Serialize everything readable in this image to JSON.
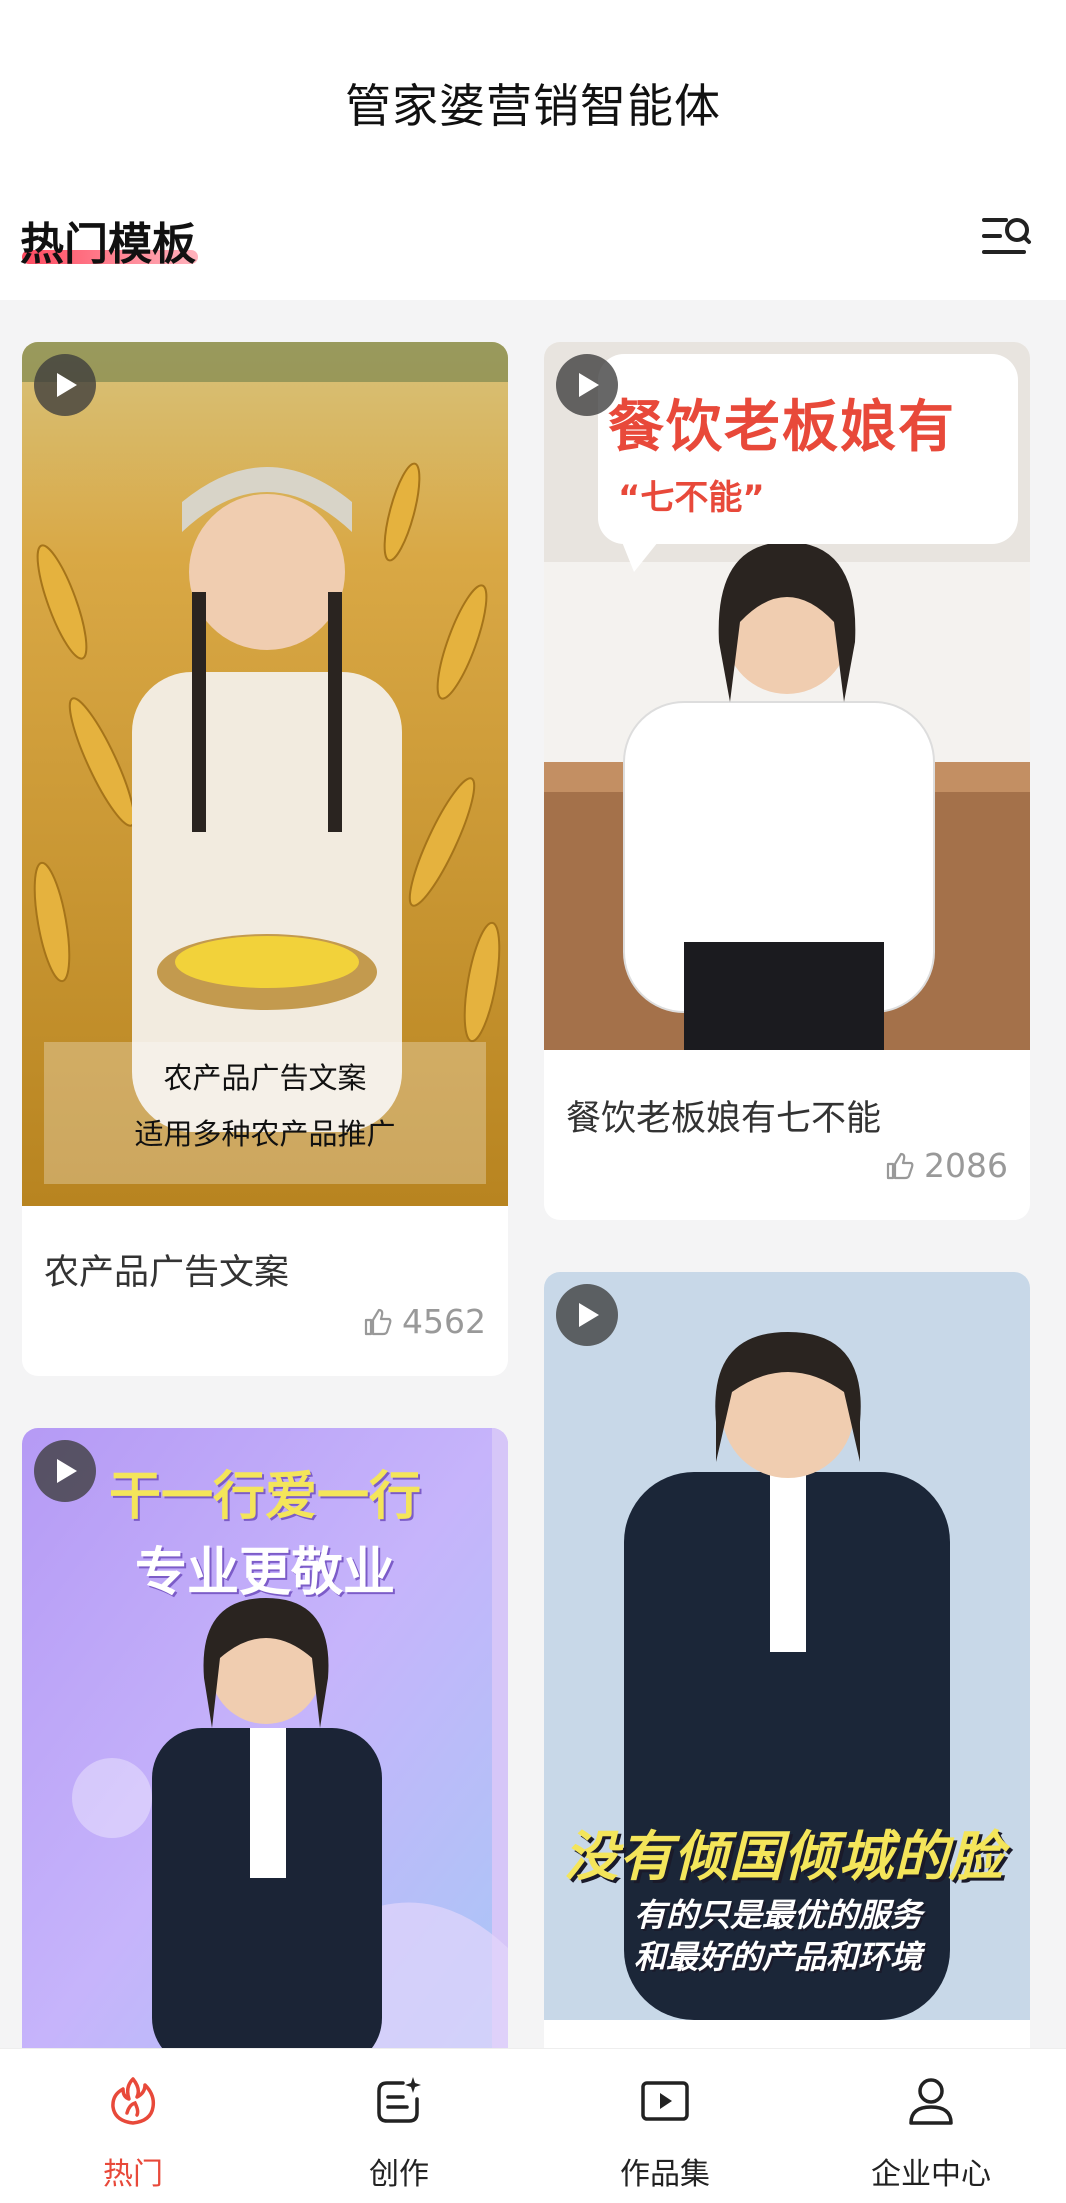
{
  "header": {
    "app_title": "管家婆营销智能体",
    "section_title": "热门模板"
  },
  "cards": [
    {
      "title": "农产品广告文案",
      "likes": "4562",
      "overlay_line1": "农产品广告文案",
      "overlay_line2": "适用多种农产品推广"
    },
    {
      "title": "餐饮老板娘有七不能",
      "likes": "2086",
      "bubble_line1": "餐饮老板娘有",
      "bubble_line2": "“七不能”"
    },
    {
      "title_line1": "干一行爱一行",
      "title_line2": "专业更敬业"
    },
    {
      "slogan_line1": "没有倾国倾城的脸",
      "slogan_line2": "有的只是最优的服务",
      "slogan_line3": "和最好的产品和环境"
    }
  ],
  "nav": [
    {
      "label": "热门",
      "icon": "fire-icon",
      "active": true
    },
    {
      "label": "创作",
      "icon": "create-icon",
      "active": false
    },
    {
      "label": "作品集",
      "icon": "video-icon",
      "active": false
    },
    {
      "label": "企业中心",
      "icon": "user-icon",
      "active": false
    }
  ],
  "colors": {
    "accent": "#e8493a",
    "background": "#f4f4f5"
  }
}
